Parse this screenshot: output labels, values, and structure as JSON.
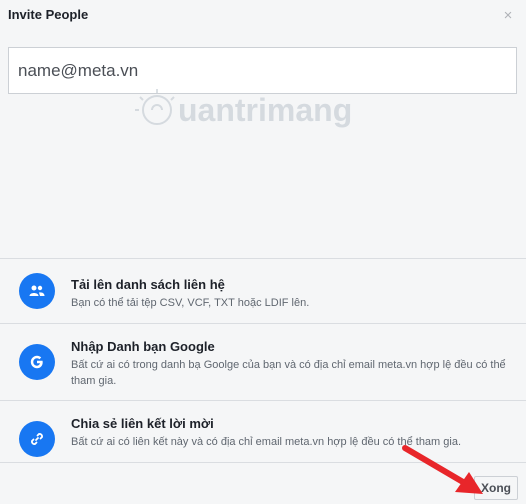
{
  "dialog": {
    "title": "Invite People",
    "close_label": "×"
  },
  "email_input": {
    "value": "name@meta.vn"
  },
  "watermark": {
    "text": "uantrimang"
  },
  "options": [
    {
      "title": "Tải lên danh sách liên hệ",
      "description": "Bạn có thể tải tệp CSV, VCF, TXT hoặc LDIF lên.",
      "icon": "contacts-upload-icon"
    },
    {
      "title": "Nhập Danh bạn Google",
      "description": "Bất cứ ai có trong danh bạ Goolge của bạn và có địa chỉ email meta.vn hợp lệ đều có thể tham gia.",
      "icon": "google-icon"
    },
    {
      "title": "Chia sẻ liên kết lời mời",
      "description": "Bất cứ ai có liên kết này và có địa chỉ email meta.vn hợp lệ đều có thể tham gia.",
      "icon": "link-icon"
    }
  ],
  "footer": {
    "done_label": "Xong"
  },
  "colors": {
    "accent": "#1877f2",
    "annotation_arrow": "#e8262a"
  }
}
